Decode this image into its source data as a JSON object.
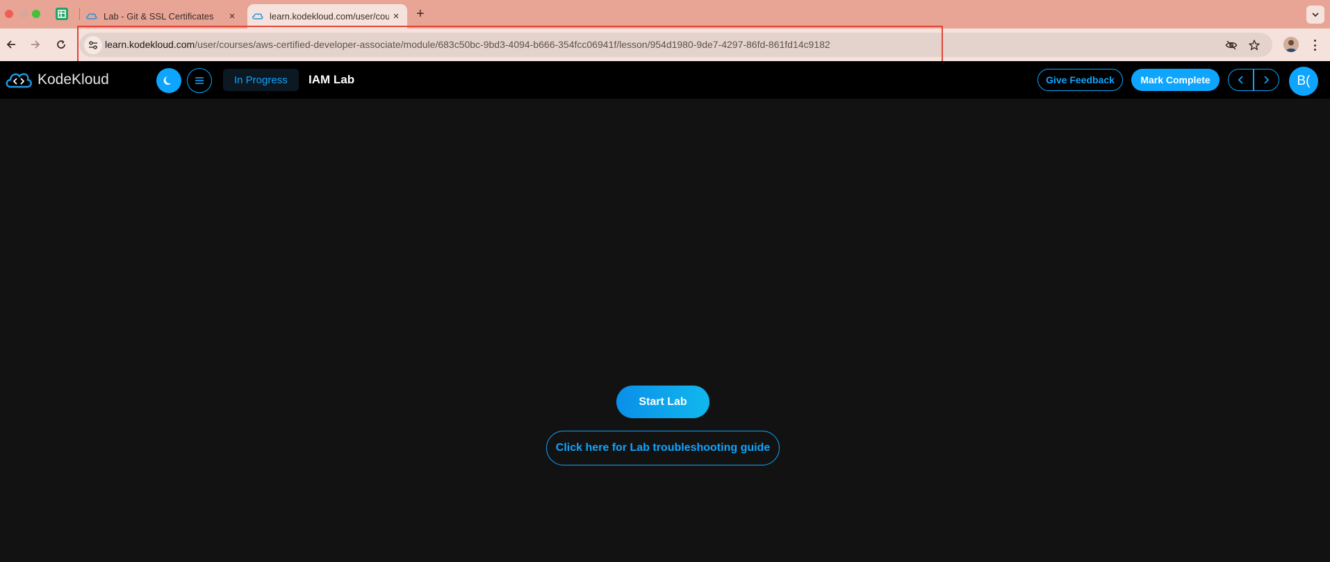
{
  "browser": {
    "tabs": [
      {
        "title": "Lab - Git & SSL Certificates -",
        "active": false
      },
      {
        "title": "learn.kodekloud.com/user/cou",
        "active": true
      }
    ],
    "new_tab_label": "+",
    "url_host": "learn.kodekloud.com",
    "url_path": "/user/courses/aws-certified-developer-associate/module/683c50bc-9bd3-4094-b666-354fcc06941f/lesson/954d1980-9de7-4297-86fd-861fd14c9182"
  },
  "app": {
    "brand": "KodeKloud",
    "status": "In Progress",
    "lesson_title": "IAM Lab",
    "feedback_label": "Give Feedback",
    "complete_label": "Mark Complete",
    "avatar_initials": "B("
  },
  "main": {
    "start_label": "Start Lab",
    "guide_label": "Click here for Lab troubleshooting guide"
  },
  "colors": {
    "accent": "#0ea5ff",
    "tabbar": "#e8a595",
    "toolbar": "#f6e2dc",
    "highlight": "#e04436",
    "background": "#121212"
  }
}
